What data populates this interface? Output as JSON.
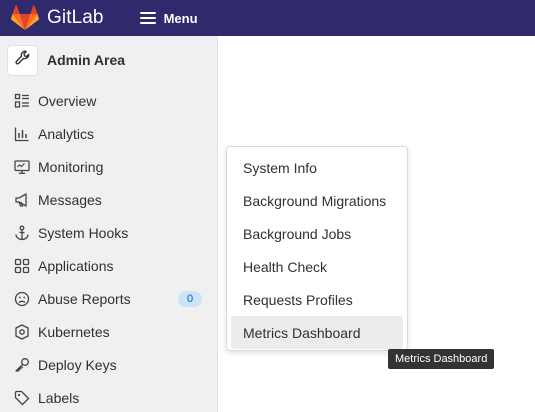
{
  "topbar": {
    "brand_name": "GitLab",
    "menu_label": "Menu"
  },
  "sidebar": {
    "title": "Admin Area",
    "items": [
      {
        "label": "Overview",
        "icon": "overview-icon"
      },
      {
        "label": "Analytics",
        "icon": "chart-icon"
      },
      {
        "label": "Monitoring",
        "icon": "monitor-icon"
      },
      {
        "label": "Messages",
        "icon": "megaphone-icon"
      },
      {
        "label": "System Hooks",
        "icon": "anchor-icon"
      },
      {
        "label": "Applications",
        "icon": "apps-icon"
      },
      {
        "label": "Abuse Reports",
        "icon": "abuse-icon",
        "badge": "0"
      },
      {
        "label": "Kubernetes",
        "icon": "kubernetes-icon"
      },
      {
        "label": "Deploy Keys",
        "icon": "key-icon"
      },
      {
        "label": "Labels",
        "icon": "label-icon"
      }
    ]
  },
  "flyout": {
    "items": [
      {
        "label": "System Info"
      },
      {
        "label": "Background Migrations"
      },
      {
        "label": "Background Jobs"
      },
      {
        "label": "Health Check"
      },
      {
        "label": "Requests Profiles"
      },
      {
        "label": "Metrics Dashboard"
      }
    ]
  },
  "tooltip": {
    "text": "Metrics Dashboard"
  },
  "colors": {
    "topbar": "#2f2a6b",
    "sidebar": "#f0f0f0",
    "badge_bg": "#cbe2f9",
    "badge_text": "#0b5cad",
    "tooltip_bg": "#333333"
  }
}
